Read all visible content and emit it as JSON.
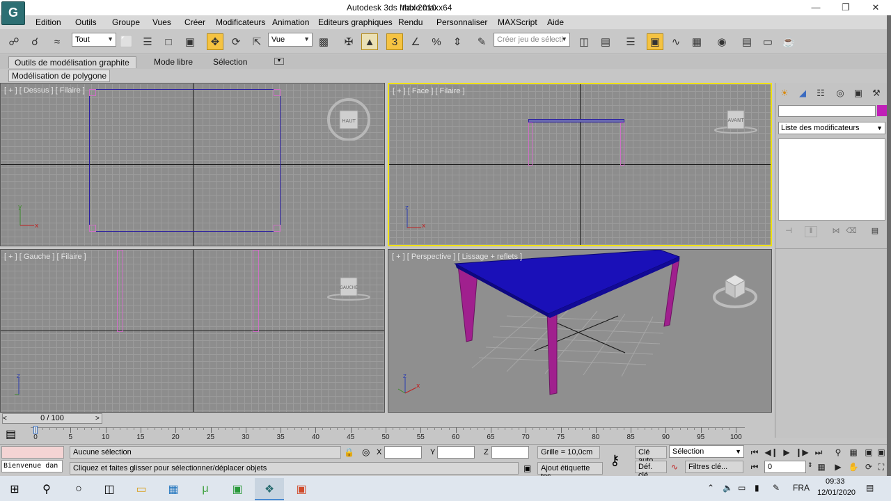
{
  "window": {
    "title_app": "Autodesk 3ds Max  2010 x64",
    "title_file": "table.max",
    "app_button_glyph": "G"
  },
  "menu": [
    "Edition",
    "Outils",
    "Groupe",
    "Vues",
    "Créer",
    "Modificateurs",
    "Animation",
    "Editeurs graphiques",
    "Rendu",
    "Personnaliser",
    "MAXScript",
    "Aide"
  ],
  "toolbar": {
    "selection_filter": "Tout",
    "reference_coord": "Vue",
    "named_selection_placeholder": "Créer jeu de sélecti",
    "snap_label": "3"
  },
  "ribbon": {
    "tabs": [
      "Outils de modélisation graphite",
      "Mode libre",
      "Sélection"
    ],
    "panel": "Modélisation de polygone"
  },
  "viewports": {
    "top_label": "[ + ] [ Dessus ] [ Filaire ]",
    "front_label": "[ + ] [ Face ] [ Filaire ]",
    "left_label": "[ + ] [ Gauche ] [ Filaire ]",
    "persp_label": "[ + ] [ Perspective ] [ Lissage + reflets ]",
    "cube_top": "HAUT",
    "cube_front": "AVANT",
    "cube_left": "GAUCHE"
  },
  "command_panel": {
    "modifier_list": "Liste des modificateurs",
    "object_color": "#c020b8"
  },
  "timeline": {
    "frame_display": "0 / 100",
    "ticks": [
      "0",
      "5",
      "10",
      "15",
      "20",
      "25",
      "30",
      "35",
      "40",
      "45",
      "50",
      "55",
      "60",
      "65",
      "70",
      "75",
      "80",
      "85",
      "90",
      "95",
      "100"
    ]
  },
  "status": {
    "maxscript_listener": "Bienvenue dan",
    "selection_info": "Aucune sélection",
    "prompt": "Cliquez et faites glisser pour sélectionner/déplacer objets",
    "x_label": "X",
    "y_label": "Y",
    "z_label": "Z",
    "grid": "Grille = 10,0cm",
    "add_time_tag": "Ajout étiquette tps",
    "auto_key": "Clé auto",
    "set_key": "Déf. clé",
    "key_mode": "Sélection",
    "key_filters": "Filtres clé...",
    "current_frame": "0"
  },
  "taskbar": {
    "language": "FRA",
    "time": "09:33",
    "date": "12/01/2020"
  },
  "colors": {
    "table_top": "#1a10b8",
    "table_legs": "#a0208e",
    "active_viewport_border": "#f0e100"
  }
}
